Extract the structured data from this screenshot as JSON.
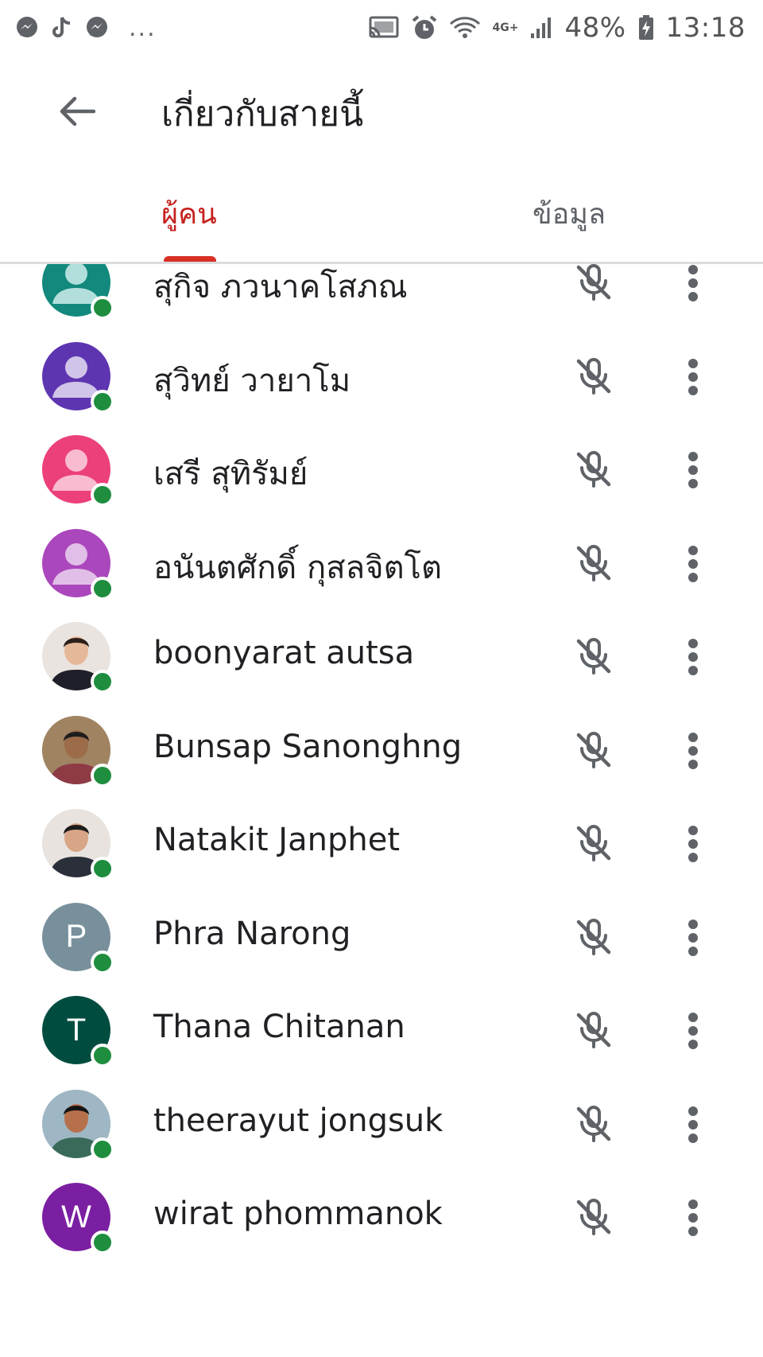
{
  "status_bar": {
    "left_icons": [
      "messenger-icon",
      "tiktok-icon",
      "messenger-icon"
    ],
    "more": "...",
    "network": "4G+",
    "battery": "48%",
    "time": "13:18"
  },
  "header": {
    "title": "เกี่ยวกับสายนี้",
    "back_icon": "arrow-left-icon"
  },
  "tabs": [
    {
      "label": "ผู้คน",
      "active": true
    },
    {
      "label": "ข้อมูล",
      "active": false
    }
  ],
  "accent_color": "#d93025",
  "participants": [
    {
      "name": "สุกิจ ภวนาคโสภณ",
      "avatar_type": "default",
      "avatar_color": "#12897c",
      "avatar_fg": "#b2dfdb",
      "online": true,
      "muted": true
    },
    {
      "name": "สุวิทย์ วายาโม",
      "avatar_type": "default",
      "avatar_color": "#5e35b1",
      "avatar_fg": "#d1c4e9",
      "online": true,
      "muted": true
    },
    {
      "name": "เสรี สุทิรัมย์",
      "avatar_type": "default",
      "avatar_color": "#ec407a",
      "avatar_fg": "#f8bbd0",
      "online": true,
      "muted": true
    },
    {
      "name": "อนันตศักดิ์ กุสลจิตโต",
      "avatar_type": "default",
      "avatar_color": "#ab47bc",
      "avatar_fg": "#e1bee7",
      "online": true,
      "muted": true
    },
    {
      "name": "boonyarat autsa",
      "avatar_type": "photo",
      "avatar_color": "#e9e4e0",
      "photo_skin": "#e6b89a",
      "photo_hair": "#2b1f1a",
      "photo_shirt": "#1f1f2a",
      "online": true,
      "muted": true
    },
    {
      "name": "Bunsap Sanonghng",
      "avatar_type": "photo",
      "avatar_color": "#a08462",
      "photo_skin": "#9b6b4a",
      "photo_hair": "#1d1d1d",
      "photo_shirt": "#8e3b46",
      "online": true,
      "muted": true
    },
    {
      "name": "Natakit Janphet",
      "avatar_type": "photo",
      "avatar_color": "#e8e3de",
      "photo_skin": "#d8a586",
      "photo_hair": "#1b1b1b",
      "photo_shirt": "#2a2f3a",
      "online": true,
      "muted": true
    },
    {
      "name": "Phra Narong",
      "avatar_type": "letter",
      "letter": "P",
      "avatar_color": "#78909c",
      "online": true,
      "muted": true
    },
    {
      "name": "Thana Chitanan",
      "avatar_type": "letter",
      "letter": "T",
      "avatar_color": "#004d40",
      "online": true,
      "muted": true
    },
    {
      "name": "theerayut jongsuk",
      "avatar_type": "photo",
      "avatar_color": "#9fb7c4",
      "photo_skin": "#b7704c",
      "photo_hair": "#141414",
      "photo_shirt": "#3a6b5a",
      "online": true,
      "muted": true
    },
    {
      "name": "wirat phommanok",
      "avatar_type": "letter",
      "letter": "W",
      "avatar_color": "#7b1fa2",
      "online": true,
      "muted": true
    }
  ]
}
